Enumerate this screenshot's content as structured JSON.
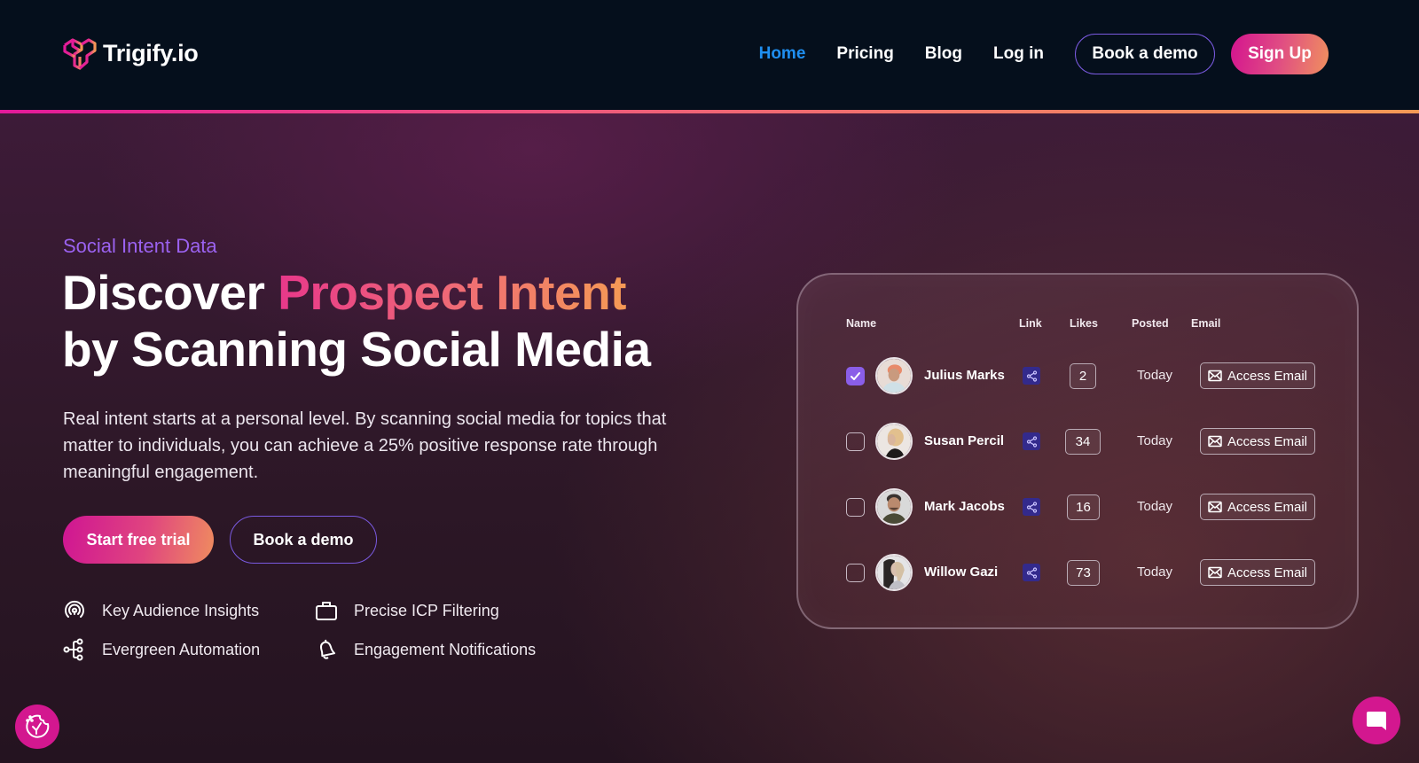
{
  "header": {
    "brand": "Trigify.io",
    "logo_icon": "trigify-logo-icon",
    "nav": [
      {
        "label": "Home",
        "active": true
      },
      {
        "label": "Pricing",
        "active": false
      },
      {
        "label": "Blog",
        "active": false
      },
      {
        "label": "Log in",
        "active": false
      }
    ],
    "book_demo_label": "Book a demo",
    "signup_label": "Sign Up"
  },
  "hero": {
    "eyebrow": "Social Intent Data",
    "headline_part1": "Discover ",
    "headline_highlight": "Prospect Intent",
    "headline_part2": "by Scanning Social Media",
    "lede": "Real intent starts at a personal level. By scanning social media for topics that matter to individuals, you can achieve a 25% positive response rate through meaningful engagement.",
    "cta_primary": "Start free trial",
    "cta_secondary": "Book a demo",
    "features": [
      {
        "icon": "broadcast-icon",
        "label": "Key Audience Insights"
      },
      {
        "icon": "briefcase-icon",
        "label": "Precise ICP Filtering"
      },
      {
        "icon": "workflow-icon",
        "label": "Evergreen Automation"
      },
      {
        "icon": "bell-icon",
        "label": "Engagement Notifications"
      }
    ]
  },
  "table": {
    "columns": [
      "Name",
      "Link",
      "Likes",
      "Posted",
      "Email"
    ],
    "rows": [
      {
        "name": "Julius Marks",
        "checked": true,
        "likes": "2",
        "posted": "Today",
        "email_action": "Access Email"
      },
      {
        "name": "Susan Percil",
        "checked": false,
        "likes": "34",
        "posted": "Today",
        "email_action": "Access Email"
      },
      {
        "name": "Mark Jacobs",
        "checked": false,
        "likes": "16",
        "posted": "Today",
        "email_action": "Access Email"
      },
      {
        "name": "Willow Gazi",
        "checked": false,
        "likes": "73",
        "posted": "Today",
        "email_action": "Access Email"
      }
    ]
  },
  "widgets": {
    "cookie_icon": "cookie-consent-icon",
    "chat_icon": "chat-bubble-icon"
  },
  "colors": {
    "accent_pink": "#d3178f",
    "accent_orange": "#f59a55",
    "accent_purple": "#9b62f0",
    "nav_active": "#1f8ff0",
    "link_badge": "#332a8c"
  }
}
